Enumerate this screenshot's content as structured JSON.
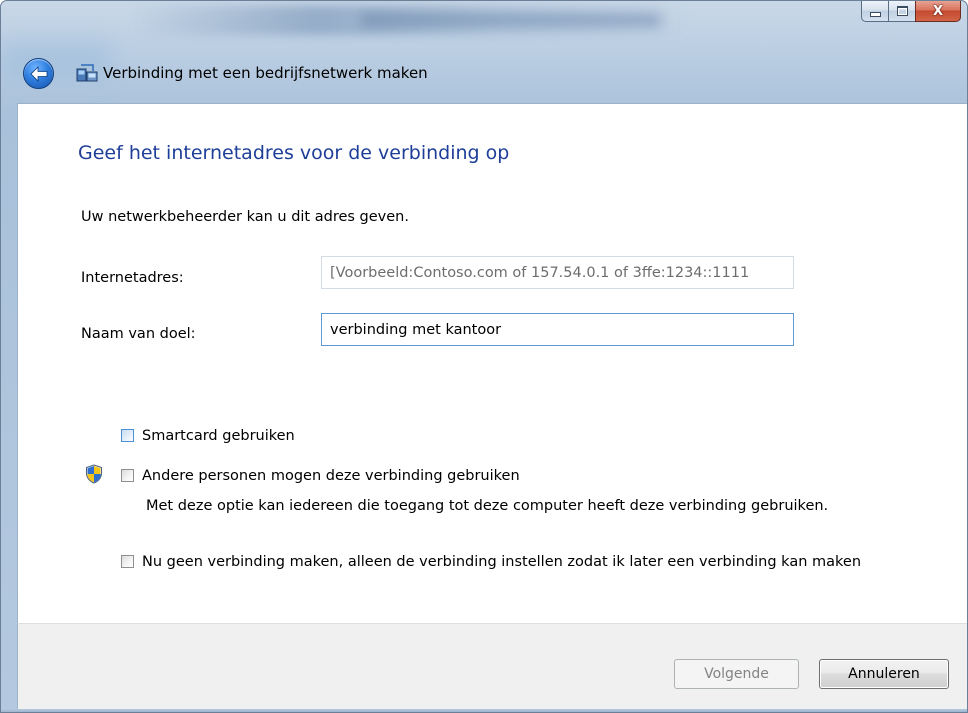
{
  "window": {
    "title": "Verbinding met een bedrijfsnetwerk maken",
    "controls": {
      "close_glyph": "X"
    }
  },
  "page": {
    "heading": "Geef het internetadres voor de verbinding op",
    "subtext": "Uw netwerkbeheerder kan u dit adres geven."
  },
  "fields": {
    "address": {
      "label": "Internetadres:",
      "value": "",
      "placeholder": "[Voorbeeld:Contoso.com of 157.54.0.1 of 3ffe:1234::1111"
    },
    "destination": {
      "label": "Naam van doel:",
      "value": "verbinding met kantoor"
    }
  },
  "options": {
    "smartcard": {
      "label": "Smartcard gebruiken",
      "checked": false
    },
    "others": {
      "label": "Andere personen mogen deze verbinding gebruiken",
      "description": "Met deze optie kan iedereen die toegang tot deze computer heeft deze verbinding gebruiken.",
      "checked": false
    },
    "later": {
      "label": "Nu geen verbinding maken, alleen de verbinding instellen zodat ik later een verbinding kan maken",
      "checked": false
    }
  },
  "buttons": {
    "next": "Volgende",
    "cancel": "Annuleren"
  },
  "icons": {
    "back": "back-arrow-icon",
    "title": "network-connection-icon",
    "shield": "uac-shield-icon"
  },
  "colors": {
    "heading": "#1e3f99",
    "focus_border": "#5d9bd6",
    "disabled_text": "#838383"
  }
}
